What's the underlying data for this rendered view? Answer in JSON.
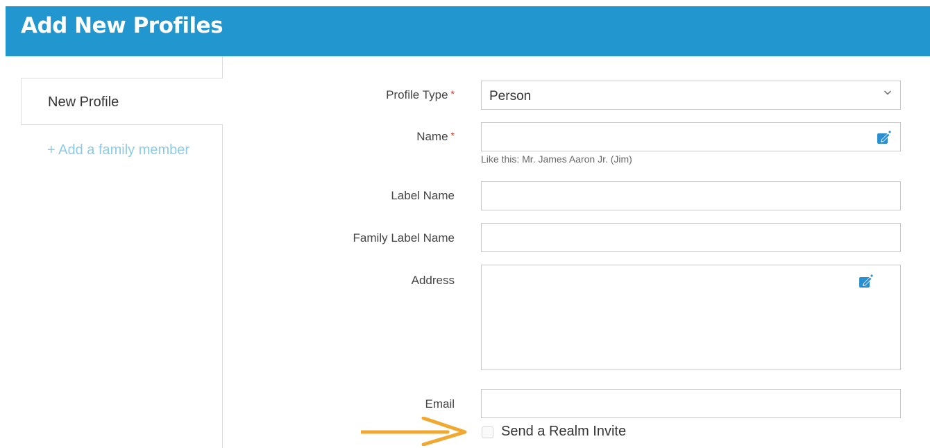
{
  "header": {
    "title": "Add New Profiles"
  },
  "sidebar": {
    "active_tab": "New Profile",
    "add_family_link": "+ Add a family member"
  },
  "form": {
    "profile_type": {
      "label": "Profile Type",
      "required_mark": "*",
      "value": "Person"
    },
    "name": {
      "label": "Name",
      "required_mark": "*",
      "value": "",
      "hint": "Like this: Mr. James Aaron Jr. (Jim)"
    },
    "label_name": {
      "label": "Label Name",
      "value": ""
    },
    "family_label_name": {
      "label": "Family Label Name",
      "value": ""
    },
    "address": {
      "label": "Address",
      "value": ""
    },
    "email": {
      "label": "Email",
      "value": ""
    },
    "realm_invite": {
      "label": "Send a Realm Invite",
      "checked": false
    }
  },
  "colors": {
    "header_bg": "#2196cf",
    "link": "#8ccbe7",
    "required": "#c0392b",
    "edit_icon": "#2a8fd0",
    "annotation_arrow": "#f0a830"
  }
}
